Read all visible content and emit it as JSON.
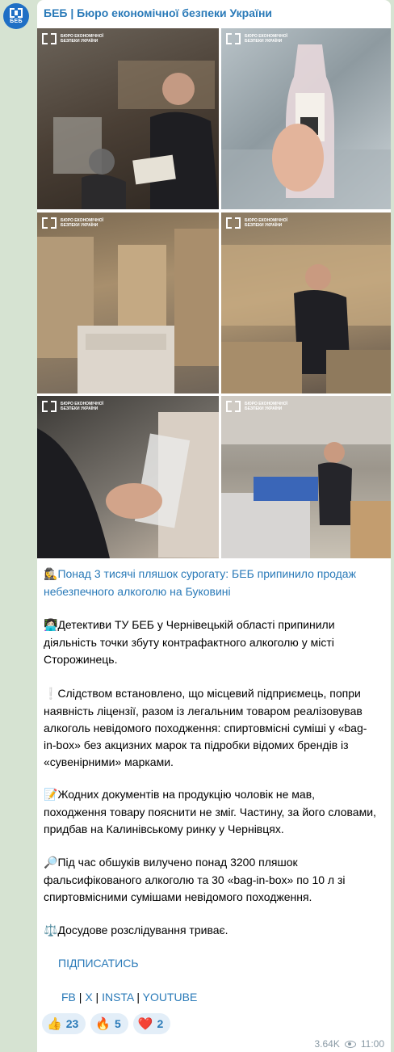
{
  "channel": {
    "name": "БЕБ | Бюро економічної безпеки України",
    "avatar_text": "БЕБ"
  },
  "photos": {
    "logo_text": "БЮРО ЕКОНОМІЧНОЇ БЕЗПЕКИ УКРАЇНИ",
    "items": [
      {
        "label": "photo-1"
      },
      {
        "label": "photo-2"
      },
      {
        "label": "photo-3"
      },
      {
        "label": "photo-4"
      },
      {
        "label": "photo-5"
      },
      {
        "label": "photo-6"
      }
    ]
  },
  "post": {
    "headline_emoji": "🕵️‍♀️",
    "headline": "Понад 3 тисячі пляшок сурогату: БЕБ припинило продаж небезпечного алкоголю на Буковині",
    "p1_emoji": "👩🏻‍💻",
    "p1": "Детективи ТУ БЕБ у Чернівецькій області припинили діяльність точки збуту контрафактного алкоголю у місті Сторожинець.",
    "p2_emoji": "❕",
    "p2": "Слідством встановлено, що місцевий підприємець, попри наявність ліцензії, разом із легальним товаром реалізовував алкоголь невідомого походження: спиртовмісні суміші у «bag-in-box» без акцизних марок та підробки відомих брендів із «сувенірними» марками.",
    "p3_emoji": "📝",
    "p3": "Жодних документів на продукцію чоловік не мав, походження товару пояснити не зміг. Частину, за його словами, придбав на Калинівському ринку у Чернівцях.",
    "p4_emoji": "🔎",
    "p4": "Під час обшуків вилучено понад 3200 пляшок фальсифікованого алкоголю та 30 «bag-in-box» по 10 л зі спиртовмісними сумішами невідомого походження.",
    "p5_emoji": "⚖️",
    "p5": "Досудове розслідування триває.",
    "subscribe": "ПІДПИСАТИСЬ",
    "social": {
      "fb": "FB",
      "x": "X",
      "insta": "INSTA",
      "youtube": "YOUTUBE",
      "sep": " | "
    }
  },
  "reactions": [
    {
      "emoji": "👍",
      "count": "23"
    },
    {
      "emoji": "🔥",
      "count": "5"
    },
    {
      "emoji": "❤️",
      "count": "2"
    }
  ],
  "meta": {
    "views": "3.64K",
    "time": "11:00"
  }
}
